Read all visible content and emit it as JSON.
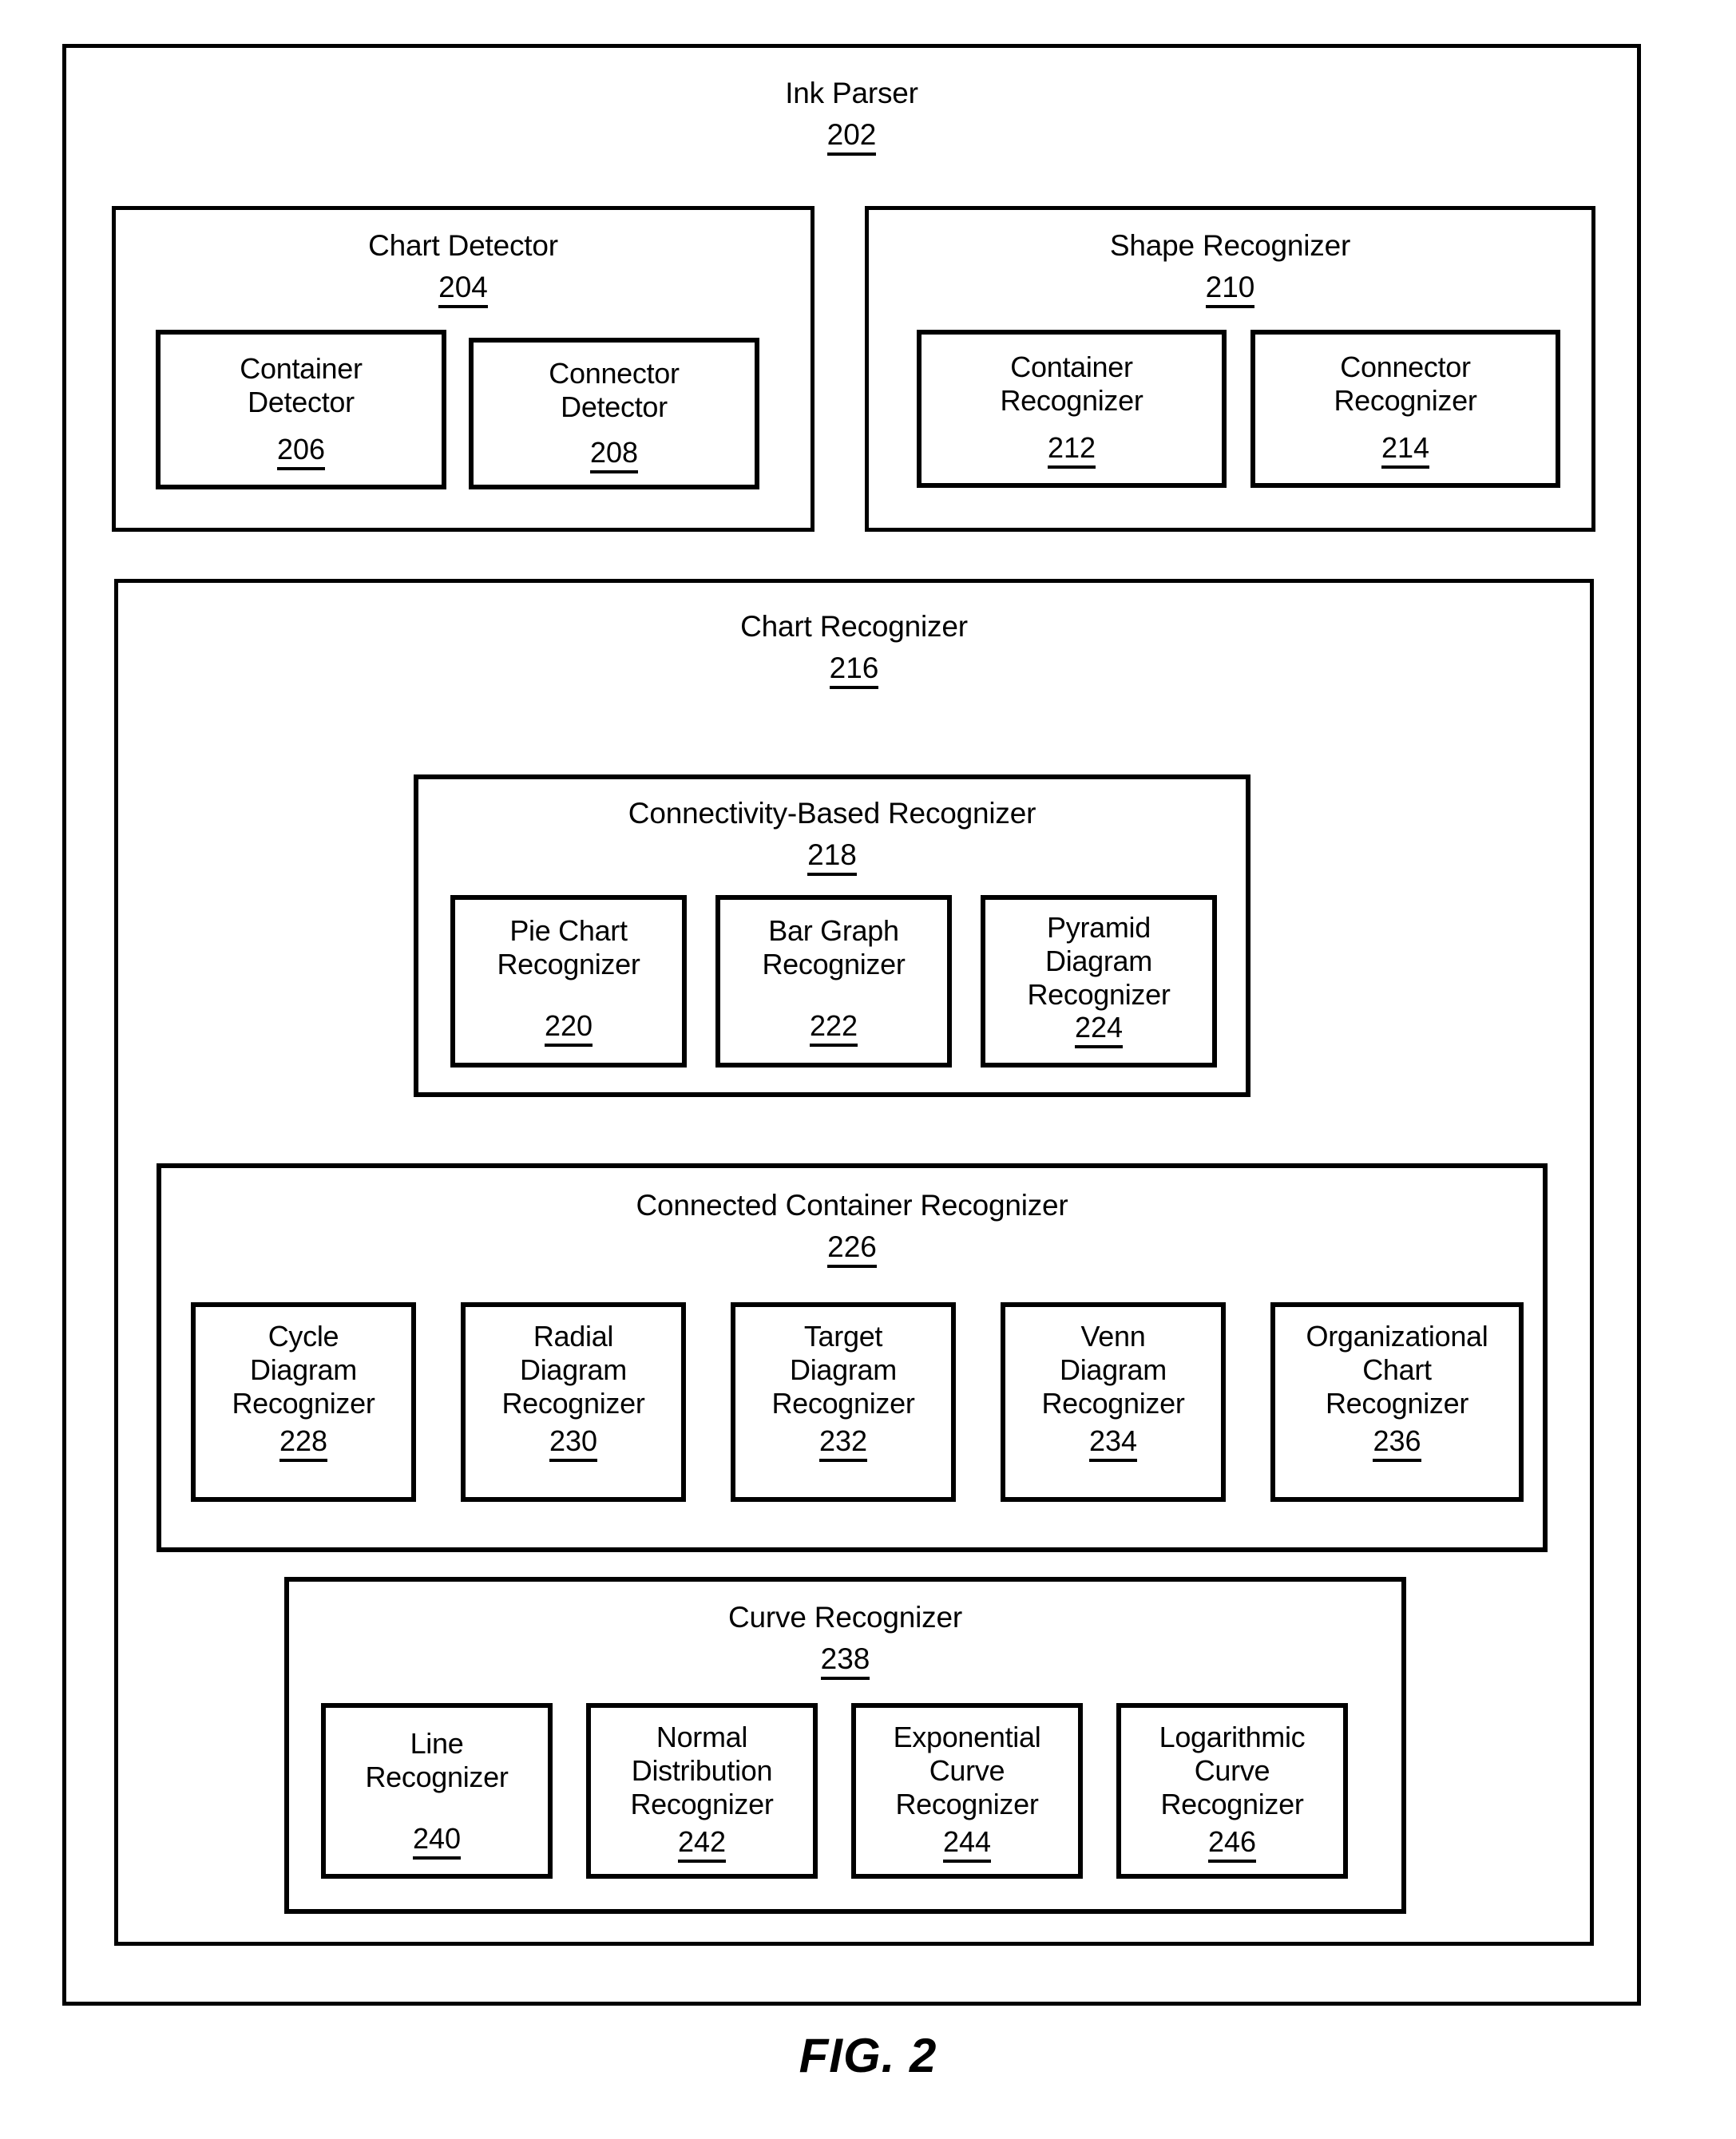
{
  "figure": {
    "caption": "FIG. 2"
  },
  "ink_parser": {
    "title": "Ink Parser",
    "ref": "202"
  },
  "chart_detector": {
    "title": "Chart Detector",
    "ref": "204",
    "children": [
      {
        "label_line1": "Container",
        "label_line2": "Detector",
        "ref": "206"
      },
      {
        "label_line1": "Connector",
        "label_line2": "Detector",
        "ref": "208"
      }
    ]
  },
  "shape_recognizer": {
    "title": "Shape Recognizer",
    "ref": "210",
    "children": [
      {
        "label_line1": "Container",
        "label_line2": "Recognizer",
        "ref": "212"
      },
      {
        "label_line1": "Connector",
        "label_line2": "Recognizer",
        "ref": "214"
      }
    ]
  },
  "chart_recognizer": {
    "title": "Chart Recognizer",
    "ref": "216",
    "connectivity_based": {
      "title": "Connectivity-Based Recognizer",
      "ref": "218",
      "children": [
        {
          "label_line1": "Pie Chart",
          "label_line2": "Recognizer",
          "label_line3": "",
          "ref": "220"
        },
        {
          "label_line1": "Bar Graph",
          "label_line2": "Recognizer",
          "label_line3": "",
          "ref": "222"
        },
        {
          "label_line1": "Pyramid",
          "label_line2": "Diagram",
          "label_line3": "Recognizer",
          "ref": "224"
        }
      ]
    },
    "connected_container": {
      "title": "Connected Container Recognizer",
      "ref": "226",
      "children": [
        {
          "label_line1": "Cycle",
          "label_line2": "Diagram",
          "label_line3": "Recognizer",
          "ref": "228"
        },
        {
          "label_line1": "Radial",
          "label_line2": "Diagram",
          "label_line3": "Recognizer",
          "ref": "230"
        },
        {
          "label_line1": "Target",
          "label_line2": "Diagram",
          "label_line3": "Recognizer",
          "ref": "232"
        },
        {
          "label_line1": "Venn",
          "label_line2": "Diagram",
          "label_line3": "Recognizer",
          "ref": "234"
        },
        {
          "label_line1": "Organizational",
          "label_line2": "Chart",
          "label_line3": "Recognizer",
          "ref": "236"
        }
      ]
    },
    "curve_recognizer": {
      "title": "Curve Recognizer",
      "ref": "238",
      "children": [
        {
          "label_line1": "Line",
          "label_line2": "Recognizer",
          "label_line3": "",
          "ref": "240"
        },
        {
          "label_line1": "Normal",
          "label_line2": "Distribution",
          "label_line3": "Recognizer",
          "ref": "242"
        },
        {
          "label_line1": "Exponential",
          "label_line2": "Curve",
          "label_line3": "Recognizer",
          "ref": "244"
        },
        {
          "label_line1": "Logarithmic",
          "label_line2": "Curve",
          "label_line3": "Recognizer",
          "ref": "246"
        }
      ]
    }
  },
  "colors": {
    "stroke": "#000000",
    "background": "#ffffff"
  }
}
